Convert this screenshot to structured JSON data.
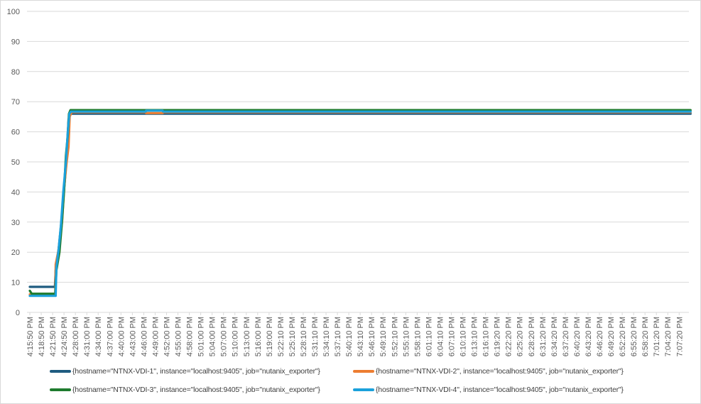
{
  "chart_data": {
    "type": "line",
    "title": "",
    "xlabel": "",
    "ylabel": "",
    "ylim": [
      0,
      100
    ],
    "yticks": [
      0,
      10,
      20,
      30,
      40,
      50,
      60,
      70,
      80,
      90,
      100
    ],
    "grid": true,
    "legend_position": "bottom",
    "x_unit": "minutes since 4:15:50 PM",
    "x_tick_interval_minutes": 3,
    "x_range": [
      0,
      174
    ],
    "x_tick_labels": [
      "4:15:50 PM",
      "4:18:50 PM",
      "4:21:50 PM",
      "4:24:50 PM",
      "4:28:00 PM",
      "4:31:00 PM",
      "4:34:00 PM",
      "4:37:00 PM",
      "4:40:00 PM",
      "4:43:00 PM",
      "4:46:00 PM",
      "4:49:00 PM",
      "4:52:00 PM",
      "4:55:00 PM",
      "4:58:00 PM",
      "5:01:00 PM",
      "5:04:00 PM",
      "5:07:00 PM",
      "5:10:00 PM",
      "5:13:00 PM",
      "5:16:00 PM",
      "5:19:00 PM",
      "5:22:10 PM",
      "5:25:10 PM",
      "5:28:10 PM",
      "5:31:10 PM",
      "5:34:10 PM",
      "5:37:10 PM",
      "5:40:10 PM",
      "5:43:10 PM",
      "5:46:10 PM",
      "5:49:10 PM",
      "5:52:10 PM",
      "5:55:10 PM",
      "5:58:10 PM",
      "6:01:10 PM",
      "6:04:10 PM",
      "6:07:10 PM",
      "6:10:10 PM",
      "6:13:10 PM",
      "6:16:10 PM",
      "6:19:20 PM",
      "6:22:20 PM",
      "6:25:20 PM",
      "6:28:20 PM",
      "6:31:20 PM",
      "6:34:20 PM",
      "6:37:20 PM",
      "6:40:20 PM",
      "6:43:20 PM",
      "6:46:20 PM",
      "6:49:20 PM",
      "6:52:20 PM",
      "6:55:20 PM",
      "6:58:20 PM",
      "7:01:20 PM",
      "7:04:20 PM",
      "7:07:20 PM"
    ],
    "series": [
      {
        "name": "{hostname=\"NTNX-VDI-1\", instance=\"localhost:9405\", job=\"nutanix_exporter\"}",
        "color": "#1f5c80",
        "points": [
          [
            0,
            8.5
          ],
          [
            6.6,
            8.5
          ],
          [
            6.8,
            14
          ],
          [
            7.5,
            20
          ],
          [
            8.3,
            30
          ],
          [
            8.6,
            35
          ],
          [
            9.3,
            45
          ],
          [
            9.8,
            55
          ],
          [
            10.2,
            64
          ],
          [
            10.6,
            66
          ],
          [
            174,
            66
          ]
        ]
      },
      {
        "name": "{hostname=\"NTNX-VDI-2\", instance=\"localhost:9405\", job=\"nutanix_exporter\"}",
        "color": "#ed7d31",
        "points": [
          [
            0,
            6
          ],
          [
            6.7,
            6
          ],
          [
            6.8,
            16
          ],
          [
            7.6,
            21
          ],
          [
            8.5,
            30
          ],
          [
            9,
            41
          ],
          [
            9.7,
            50
          ],
          [
            10.2,
            55
          ],
          [
            10.5,
            65
          ],
          [
            11,
            66.5
          ],
          [
            30.5,
            66.5
          ],
          [
            30.6,
            66.2
          ],
          [
            35,
            66.2
          ],
          [
            35.1,
            66.5
          ],
          [
            174,
            66.5
          ]
        ]
      },
      {
        "name": "{hostname=\"NTNX-VDI-3\", instance=\"localhost:9405\", job=\"nutanix_exporter\"}",
        "color": "#1e7b2e",
        "points": [
          [
            0,
            7.2
          ],
          [
            0.5,
            6.2
          ],
          [
            6.7,
            6.2
          ],
          [
            7,
            14
          ],
          [
            7.8,
            20
          ],
          [
            8.4,
            29
          ],
          [
            9,
            40
          ],
          [
            9.5,
            52
          ],
          [
            10,
            59
          ],
          [
            10.3,
            66
          ],
          [
            10.7,
            67.2
          ],
          [
            174,
            67.2
          ]
        ]
      },
      {
        "name": "{hostname=\"NTNX-VDI-4\", instance=\"localhost:9405\", job=\"nutanix_exporter\"}",
        "color": "#1ba1db",
        "points": [
          [
            0,
            5.5
          ],
          [
            6.8,
            5.5
          ],
          [
            7,
            15
          ],
          [
            7.6,
            21
          ],
          [
            8.2,
            29
          ],
          [
            8.8,
            40
          ],
          [
            9.5,
            50
          ],
          [
            10,
            60
          ],
          [
            10.4,
            66
          ],
          [
            10.8,
            66.7
          ],
          [
            30.5,
            66.7
          ],
          [
            30.6,
            67
          ],
          [
            35,
            67
          ],
          [
            35.1,
            66.7
          ],
          [
            174,
            66.7
          ]
        ]
      }
    ]
  }
}
